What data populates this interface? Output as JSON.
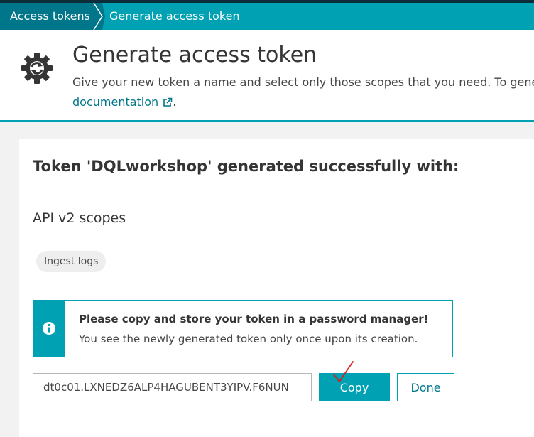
{
  "breadcrumb": {
    "items": [
      {
        "label": "Access tokens"
      },
      {
        "label": "Generate access token"
      }
    ]
  },
  "header": {
    "title": "Generate access token",
    "description": "Give your new token a name and select only those scopes that you need. To genera",
    "link_text": "documentation",
    "link_suffix": "."
  },
  "result": {
    "title": "Token 'DQLworkshop' generated successfully with:",
    "scopes_heading": "API v2 scopes",
    "scopes": [
      "Ingest logs"
    ]
  },
  "notice": {
    "heading": "Please copy and store your token in a password manager!",
    "text": "You see the newly generated token only once upon its creation."
  },
  "token": {
    "value": "dt0c01.LXNEDZ6ALP4HAGUBENT3YIPV.F6NUN"
  },
  "actions": {
    "copy_label": "Copy",
    "done_label": "Done"
  },
  "colors": {
    "accent": "#00a1b2",
    "accent_dark": "#00768a",
    "annotation": "#d42020"
  },
  "icons": {
    "header": "gear-sync-icon",
    "info": "info-icon",
    "external_link": "external-link-icon",
    "annotation": "checkmark-annotation-icon"
  }
}
